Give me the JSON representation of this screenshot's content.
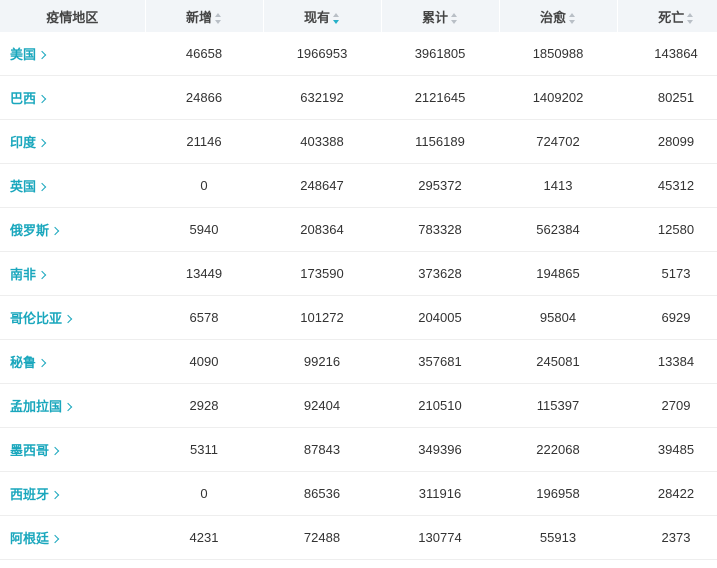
{
  "headers": [
    "疫情地区",
    "新增",
    "现有",
    "累计",
    "治愈",
    "死亡"
  ],
  "sort_active_column": "现有",
  "accent_color": "#1aa7bd",
  "rows": [
    {
      "region": "美国",
      "new": "46658",
      "current": "1966953",
      "total": "3961805",
      "cured": "1850988",
      "death": "143864"
    },
    {
      "region": "巴西",
      "new": "24866",
      "current": "632192",
      "total": "2121645",
      "cured": "1409202",
      "death": "80251"
    },
    {
      "region": "印度",
      "new": "21146",
      "current": "403388",
      "total": "1156189",
      "cured": "724702",
      "death": "28099"
    },
    {
      "region": "英国",
      "new": "0",
      "current": "248647",
      "total": "295372",
      "cured": "1413",
      "death": "45312"
    },
    {
      "region": "俄罗斯",
      "new": "5940",
      "current": "208364",
      "total": "783328",
      "cured": "562384",
      "death": "12580"
    },
    {
      "region": "南非",
      "new": "13449",
      "current": "173590",
      "total": "373628",
      "cured": "194865",
      "death": "5173"
    },
    {
      "region": "哥伦比亚",
      "new": "6578",
      "current": "101272",
      "total": "204005",
      "cured": "95804",
      "death": "6929"
    },
    {
      "region": "秘鲁",
      "new": "4090",
      "current": "99216",
      "total": "357681",
      "cured": "245081",
      "death": "13384"
    },
    {
      "region": "孟加拉国",
      "new": "2928",
      "current": "92404",
      "total": "210510",
      "cured": "115397",
      "death": "2709"
    },
    {
      "region": "墨西哥",
      "new": "5311",
      "current": "87843",
      "total": "349396",
      "cured": "222068",
      "death": "39485"
    },
    {
      "region": "西班牙",
      "new": "0",
      "current": "86536",
      "total": "311916",
      "cured": "196958",
      "death": "28422"
    },
    {
      "region": "阿根廷",
      "new": "4231",
      "current": "72488",
      "total": "130774",
      "cured": "55913",
      "death": "2373"
    }
  ]
}
